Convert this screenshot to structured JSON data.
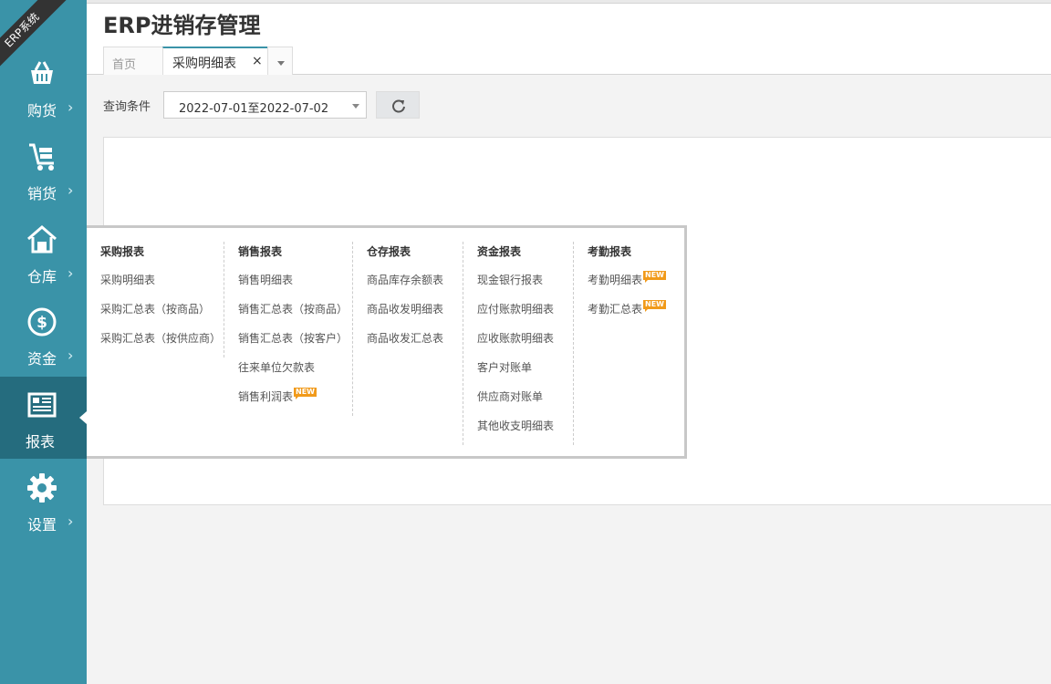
{
  "sidebar": {
    "ribbon": "ERP系统",
    "items": [
      {
        "label": "购货",
        "arrow": "›"
      },
      {
        "label": "销货",
        "arrow": "›"
      },
      {
        "label": "仓库",
        "arrow": "›"
      },
      {
        "label": "资金",
        "arrow": "›"
      },
      {
        "label": "报表"
      },
      {
        "label": "设置",
        "arrow": "›"
      }
    ]
  },
  "header": {
    "title": "ERP进销存管理",
    "tabs": [
      {
        "label": "首页"
      },
      {
        "label": "采购明细表",
        "close": "×"
      }
    ]
  },
  "query": {
    "label": "查询条件",
    "date_range": "2022-07-01至2022-07-02"
  },
  "menu": {
    "columns": [
      {
        "title": "采购报表",
        "items": [
          {
            "label": "采购明细表"
          },
          {
            "label": "采购汇总表（按商品）"
          },
          {
            "label": "采购汇总表（按供应商）"
          }
        ]
      },
      {
        "title": "销售报表",
        "items": [
          {
            "label": "销售明细表"
          },
          {
            "label": "销售汇总表（按商品）"
          },
          {
            "label": "销售汇总表（按客户）"
          },
          {
            "label": "往来单位欠款表"
          },
          {
            "label": "销售利润表",
            "badge": "NEW"
          }
        ]
      },
      {
        "title": "仓存报表",
        "items": [
          {
            "label": "商品库存余额表"
          },
          {
            "label": "商品收发明细表"
          },
          {
            "label": "商品收发汇总表"
          }
        ]
      },
      {
        "title": "资金报表",
        "items": [
          {
            "label": "现金银行报表"
          },
          {
            "label": "应付账款明细表"
          },
          {
            "label": "应收账款明细表"
          },
          {
            "label": "客户对账单"
          },
          {
            "label": "供应商对账单"
          },
          {
            "label": "其他收支明细表"
          }
        ]
      },
      {
        "title": "考勤报表",
        "items": [
          {
            "label": "考勤明细表",
            "badge": "NEW"
          },
          {
            "label": "考勤汇总表",
            "badge": "NEW"
          }
        ]
      }
    ]
  },
  "colors": {
    "sidebar": "#3a93a8",
    "sidebar_active": "#256c7e",
    "badge": "#f19a1a"
  }
}
